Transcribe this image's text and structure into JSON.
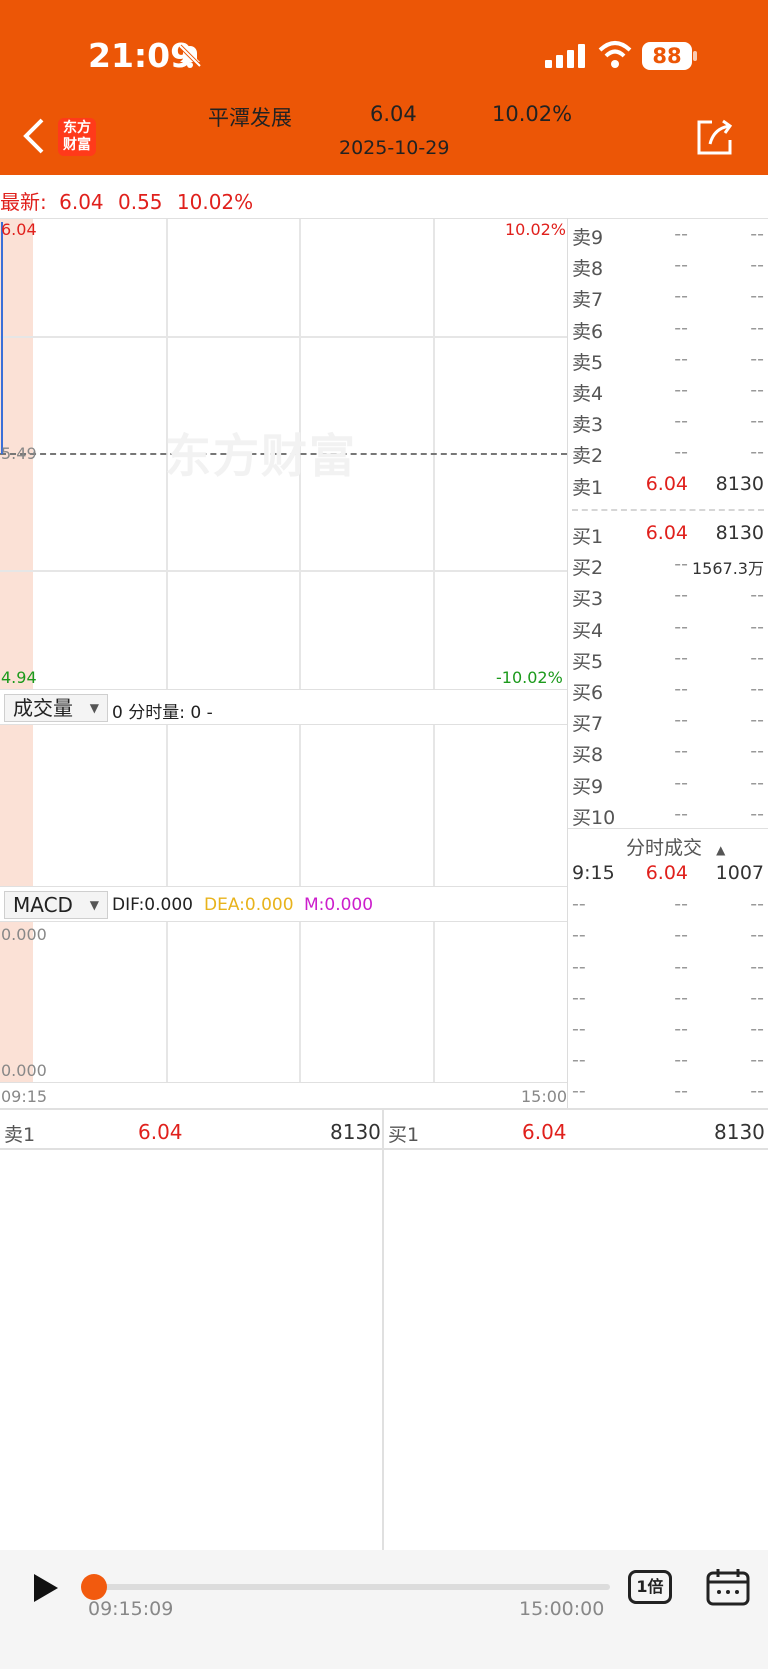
{
  "status_bar": {
    "time": "21:09",
    "battery": "88"
  },
  "header": {
    "stock_name": "平潭发展",
    "price": "6.04",
    "change_pct": "10.02%",
    "date": "2025-10-29",
    "logo_text": "东方财富"
  },
  "latest": {
    "label": "最新:",
    "price": "6.04",
    "change": "0.55",
    "change_pct": "10.02%"
  },
  "price_chart": {
    "top_left": "6.04",
    "top_right": "10.02%",
    "mid_left": "5.49",
    "bottom_left": "4.94",
    "bottom_right": "-10.02%",
    "watermark": "东方财富"
  },
  "volume_panel": {
    "selector": "成交量",
    "summary": "0 分时量: 0 -"
  },
  "macd_panel": {
    "selector": "MACD",
    "dif": "DIF:0.000",
    "dea": "DEA:0.000",
    "m": "M:0.000",
    "top_value": "0.000",
    "bottom_value": "0.000"
  },
  "time_axis": {
    "start": "09:15",
    "end": "15:00"
  },
  "order_book": {
    "asks": [
      {
        "label": "卖9",
        "price": "--",
        "vol": "--"
      },
      {
        "label": "卖8",
        "price": "--",
        "vol": "--"
      },
      {
        "label": "卖7",
        "price": "--",
        "vol": "--"
      },
      {
        "label": "卖6",
        "price": "--",
        "vol": "--"
      },
      {
        "label": "卖5",
        "price": "--",
        "vol": "--"
      },
      {
        "label": "卖4",
        "price": "--",
        "vol": "--"
      },
      {
        "label": "卖3",
        "price": "--",
        "vol": "--"
      },
      {
        "label": "卖2",
        "price": "--",
        "vol": "--"
      },
      {
        "label": "卖1",
        "price": "6.04",
        "vol": "8130"
      }
    ],
    "bids": [
      {
        "label": "买1",
        "price": "6.04",
        "vol": "8130"
      },
      {
        "label": "买2",
        "price": "--",
        "vol": "1567.3万"
      },
      {
        "label": "买3",
        "price": "--",
        "vol": "--"
      },
      {
        "label": "买4",
        "price": "--",
        "vol": "--"
      },
      {
        "label": "买5",
        "price": "--",
        "vol": "--"
      },
      {
        "label": "买6",
        "price": "--",
        "vol": "--"
      },
      {
        "label": "买7",
        "price": "--",
        "vol": "--"
      },
      {
        "label": "买8",
        "price": "--",
        "vol": "--"
      },
      {
        "label": "买9",
        "price": "--",
        "vol": "--"
      },
      {
        "label": "买10",
        "price": "--",
        "vol": "--"
      }
    ]
  },
  "trades": {
    "title": "分时成交",
    "rows": [
      {
        "time": "9:15",
        "price": "6.04",
        "vol": "1007"
      },
      {
        "time": "--",
        "price": "--",
        "vol": "--"
      },
      {
        "time": "--",
        "price": "--",
        "vol": "--"
      },
      {
        "time": "--",
        "price": "--",
        "vol": "--"
      },
      {
        "time": "--",
        "price": "--",
        "vol": "--"
      },
      {
        "time": "--",
        "price": "--",
        "vol": "--"
      },
      {
        "time": "--",
        "price": "--",
        "vol": "--"
      },
      {
        "time": "--",
        "price": "--",
        "vol": "--"
      }
    ]
  },
  "summary": {
    "sell_label": "卖1",
    "sell_price": "6.04",
    "sell_vol": "8130",
    "buy_label": "买1",
    "buy_price": "6.04",
    "buy_vol": "8130"
  },
  "playback": {
    "start_time": "09:15:09",
    "end_time": "15:00:00",
    "speed": "1倍",
    "progress": 0.0
  }
}
